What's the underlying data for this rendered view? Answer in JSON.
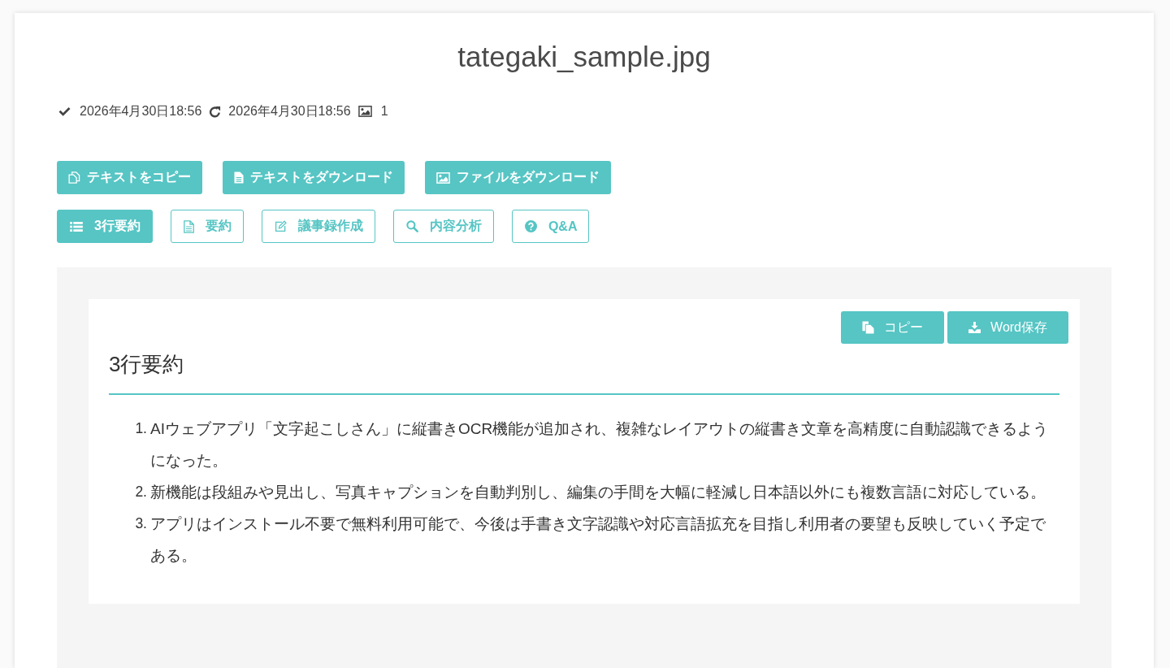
{
  "document": {
    "title": "tategaki_sample.jpg",
    "processed_at": "2026年4月30日18:56",
    "updated_at": "2026年4月30日18:56",
    "image_count": "1"
  },
  "actions": [
    {
      "kind": "copy",
      "label": "テキストをコピー"
    },
    {
      "kind": "text",
      "label": "テキストをダウンロード"
    },
    {
      "kind": "file",
      "label": "ファイルをダウンロード"
    }
  ],
  "tabs": [
    {
      "kind": "lines",
      "label": "3行要約",
      "selected": true
    },
    {
      "kind": "summary",
      "label": "要約",
      "selected": false
    },
    {
      "kind": "minutes",
      "label": "議事録作成",
      "selected": false
    },
    {
      "kind": "analysis",
      "label": "内容分析",
      "selected": false
    },
    {
      "kind": "qa",
      "label": "Q&A",
      "selected": false
    }
  ],
  "result": {
    "heading": "3行要約",
    "buttons": [
      {
        "kind": "copy",
        "label": "コピー"
      },
      {
        "kind": "word",
        "label": "Word保存"
      }
    ],
    "items": [
      {
        "number": "1.",
        "text": "AIウェブアプリ「文字起こしさん」に縦書きOCR機能が追加され、複雑なレイアウトの縦書き文章を高精度に自動認識できるようになった。"
      },
      {
        "number": "2.",
        "text": "新機能は段組みや見出し、写真キャプションを自動判別し、編集の手間を大幅に軽減し日本語以外にも複数言語に対応している。"
      },
      {
        "number": "3.",
        "text": "アプリはインストール不要で無料利用可能で、今後は手書き文字認識や対応言語拡充を目指し利用者の要望も反映していく予定である。"
      }
    ]
  }
}
